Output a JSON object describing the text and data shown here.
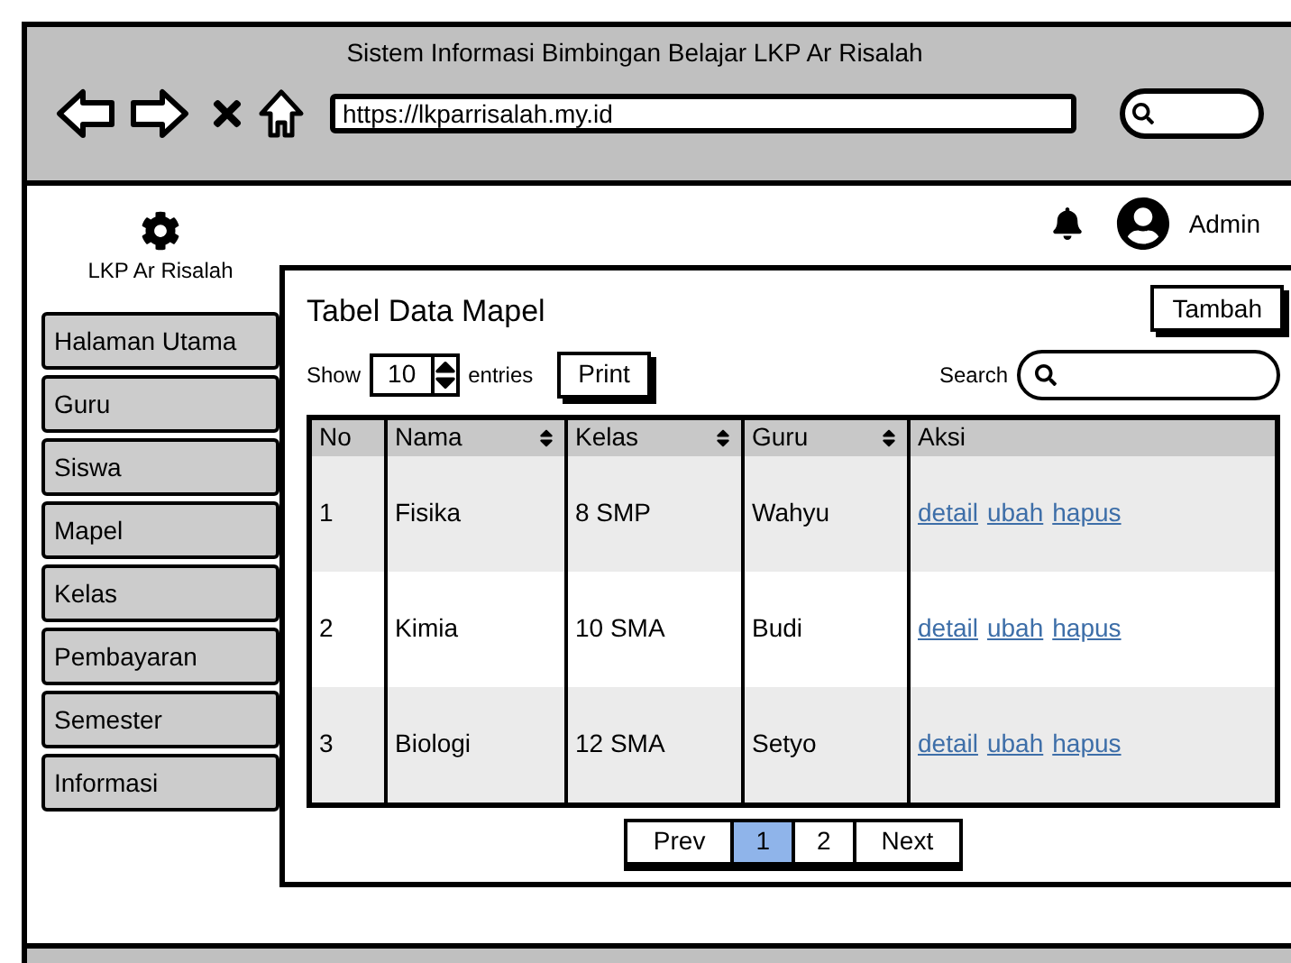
{
  "browser": {
    "title": "Sistem Informasi Bimbingan Belajar LKP Ar Risalah",
    "url": "https://lkparrisalah.my.id"
  },
  "brand": "LKP Ar Risalah",
  "user": "Admin",
  "nav": [
    {
      "label": "Halaman Utama"
    },
    {
      "label": "Guru"
    },
    {
      "label": "Siswa"
    },
    {
      "label": "Mapel"
    },
    {
      "label": "Kelas"
    },
    {
      "label": "Pembayaran"
    },
    {
      "label": "Semester"
    },
    {
      "label": "Informasi"
    }
  ],
  "panel": {
    "title": "Tabel Data Mapel",
    "add_button": "Tambah",
    "show_label": "Show",
    "entries_value": "10",
    "entries_label": "entries",
    "print_button": "Print",
    "search_label": "Search"
  },
  "table": {
    "columns": [
      {
        "label": "No",
        "sortable": false
      },
      {
        "label": "Nama",
        "sortable": true
      },
      {
        "label": "Kelas",
        "sortable": true
      },
      {
        "label": "Guru",
        "sortable": true
      },
      {
        "label": "Aksi",
        "sortable": false
      }
    ],
    "rows": [
      {
        "cells": [
          "1",
          "Fisika",
          "8 SMP",
          "Wahyu"
        ],
        "actions": [
          "detail",
          "ubah",
          "hapus"
        ]
      },
      {
        "cells": [
          "2",
          "Kimia",
          "10 SMA",
          "Budi"
        ],
        "actions": [
          "detail",
          "ubah",
          "hapus"
        ]
      },
      {
        "cells": [
          "3",
          "Biologi",
          "12 SMA",
          "Setyo"
        ],
        "actions": [
          "detail",
          "ubah",
          "hapus"
        ]
      }
    ]
  },
  "pagination": [
    {
      "label": "Prev",
      "selected": false
    },
    {
      "label": "1",
      "selected": true
    },
    {
      "label": "2",
      "selected": false
    },
    {
      "label": "Next",
      "selected": false
    }
  ]
}
